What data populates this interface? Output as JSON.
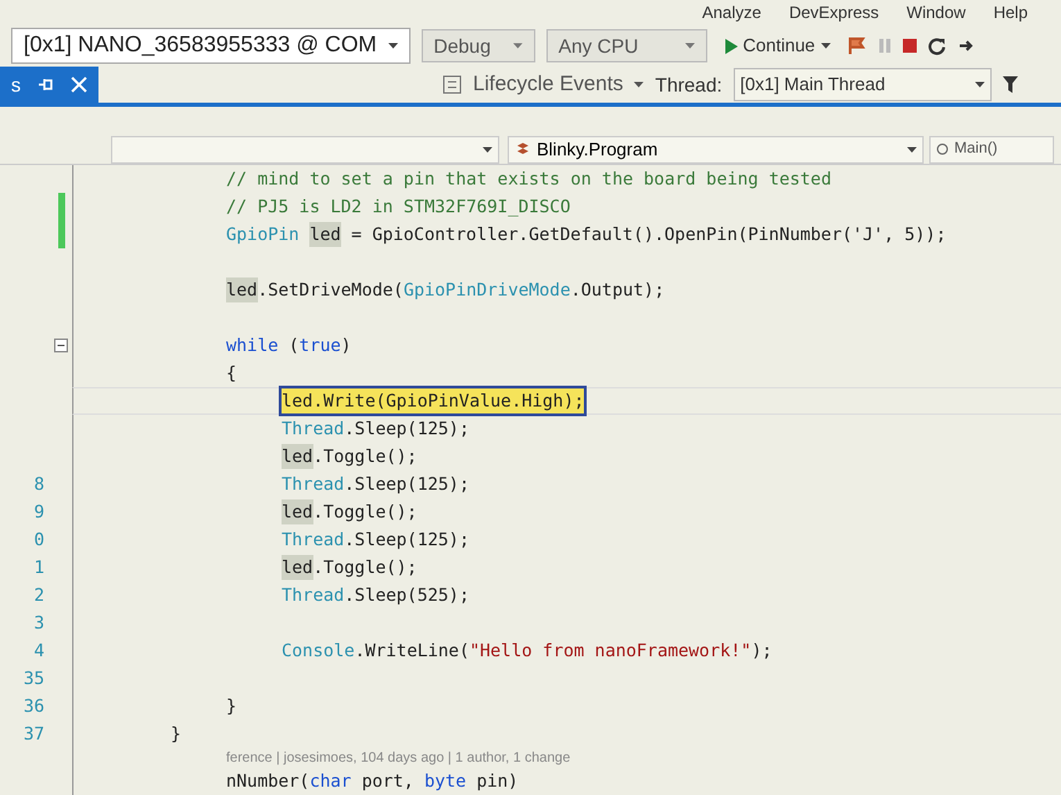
{
  "menu": [
    "Analyze",
    "DevExpress",
    "Window",
    "Help"
  ],
  "toolbar": {
    "device": "[0x1] NANO_36583955333 @ COM",
    "configuration": "Debug",
    "platform": "Any CPU",
    "continue": "Continue",
    "lifecycle": "Lifecycle Events",
    "thread_label": "Thread:",
    "thread": "[0x1] Main Thread"
  },
  "tab": {
    "label": "s",
    "selected": true
  },
  "navbar": {
    "class": "Blinky.Program",
    "member": "Main()"
  },
  "code": [
    {
      "children": [
        {
          "changed": false,
          "fold": false,
          "tokens": [
            {
              "t": "// mind to set a pin that exists on the board being tested",
              "kind": "comment"
            }
          ]
        },
        {
          "changed": true,
          "fold": false,
          "tokens": [
            {
              "t": "// PJ5 is LD2 in STM32F769I_DISCO",
              "kind": "comment"
            }
          ]
        },
        {
          "changed": true,
          "fold": false,
          "tokens": [
            {
              "t": "GpioPin",
              "kind": "type"
            },
            {
              "t": "led",
              "kind": "ref"
            },
            {
              "t": "= GpioController.GetDefault().OpenPin(PinNumber('J', 5));",
              "kind": "plain"
            }
          ]
        },
        {
          "changed": false,
          "fold": false
        },
        {
          "changed": false,
          "fold": false,
          "tokens": [
            {
              "t": "led",
              "kind": "ref"
            },
            {
              "t": ".SetDriveMode(",
              "kind": "plain"
            },
            {
              "t": "GpioPinDriveMode",
              "kind": "type"
            },
            {
              "t": ".Output);",
              "kind": "plain"
            }
          ]
        },
        {
          "changed": false,
          "fold": false
        },
        {
          "changed": false,
          "fold": true,
          "tokens": [
            {
              "t": "while",
              "kind": "keyword"
            },
            {
              "t": "(",
              "kind": "plain"
            },
            {
              "t": "true",
              "kind": "keyword"
            },
            {
              "t": ")",
              "kind": "plain"
            }
          ]
        },
        {
          "changed": false,
          "fold": false,
          "tokens": [
            {
              "t": "{",
              "kind": "plain"
            }
          ]
        },
        {
          "children": [
            {
              "changed": false,
              "fold": false,
              "current": true,
              "tokens": [
                {
                  "t": "led.Write(GpioPinValue.High);",
                  "kind": "current"
                }
              ]
            },
            {
              "changed": false,
              "fold": false,
              "tokens": [
                {
                  "t": "Thread",
                  "kind": "type"
                },
                {
                  "t": ".Sleep(125);",
                  "kind": "plain"
                }
              ]
            },
            {
              "changed": false,
              "fold": false,
              "tokens": [
                {
                  "t": "led",
                  "kind": "ref"
                },
                {
                  "t": ".Toggle();",
                  "kind": "plain"
                }
              ]
            },
            {
              "num": "8",
              "changed": false,
              "fold": false,
              "tokens": [
                {
                  "t": "Thread",
                  "kind": "type"
                },
                {
                  "t": ".Sleep(125);",
                  "kind": "plain"
                }
              ]
            },
            {
              "num": "9",
              "changed": false,
              "fold": false,
              "tokens": [
                {
                  "t": "led",
                  "kind": "ref"
                },
                {
                  "t": ".Toggle();",
                  "kind": "plain"
                }
              ]
            },
            {
              "num": "0",
              "changed": false,
              "fold": false,
              "tokens": [
                {
                  "t": "Thread",
                  "kind": "type"
                },
                {
                  "t": ".Sleep(125);",
                  "kind": "plain"
                }
              ]
            },
            {
              "num": "1",
              "changed": false,
              "fold": false,
              "tokens": [
                {
                  "t": "led",
                  "kind": "ref"
                },
                {
                  "t": ".Toggle();",
                  "kind": "plain"
                }
              ]
            },
            {
              "num": "2",
              "changed": false,
              "fold": false,
              "tokens": [
                {
                  "t": "Thread",
                  "kind": "type"
                },
                {
                  "t": ".Sleep(525);",
                  "kind": "plain"
                }
              ]
            },
            {
              "num": "3",
              "changed": false,
              "fold": false
            },
            {
              "num": "4",
              "changed": false,
              "fold": false,
              "tokens": [
                {
                  "t": "Console",
                  "kind": "type"
                },
                {
                  "t": ".WriteLine(",
                  "kind": "plain"
                },
                {
                  "t": "\"Hello from nanoFramework!\"",
                  "kind": "string"
                },
                {
                  "t": ");",
                  "kind": "plain"
                }
              ]
            },
            {
              "num": "35",
              "changed": false,
              "fold": false
            }
          ]
        },
        {
          "num": "36",
          "changed": false,
          "fold": false,
          "tokens": [
            {
              "t": "}",
              "kind": "plain"
            }
          ]
        }
      ]
    },
    {
      "num": "37",
      "changed": false,
      "fold": false,
      "tokens": [
        {
          "t": "}",
          "kind": "plain"
        }
      ]
    }
  ],
  "codelens": "ference | josesimoes, 104 days ago | 1 author, 1 change",
  "last_line": [
    {
      "t": "nNumber(",
      "kind": "plain"
    },
    {
      "t": "char",
      "kind": "keyword"
    },
    {
      "t": "port,",
      "kind": "plain"
    },
    {
      "t": "byte",
      "kind": "keyword"
    },
    {
      "t": "pin)",
      "kind": "plain"
    }
  ]
}
